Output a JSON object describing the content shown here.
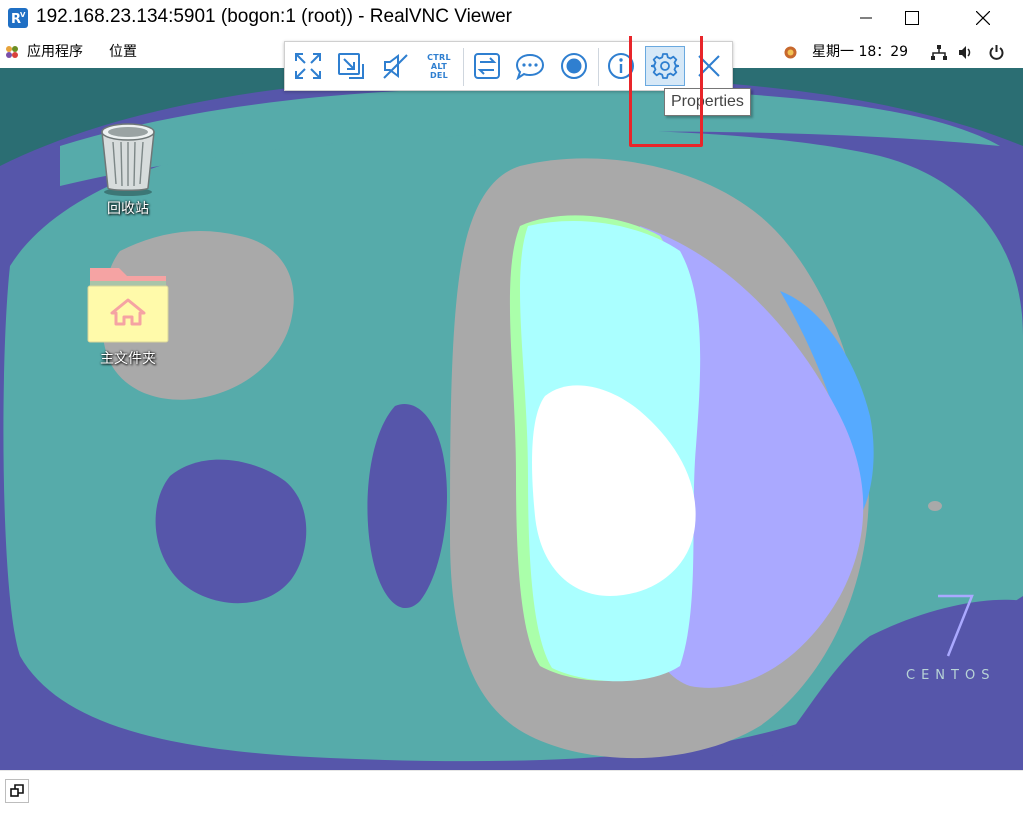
{
  "window": {
    "title": "192.168.23.134:5901 (bogon:1 (root)) - RealVNC Viewer",
    "logo_icon": "realvnc-logo-icon",
    "buttons": [
      "minimize-icon",
      "maximize-icon",
      "close-icon"
    ]
  },
  "panel": {
    "apps_menu": "应用程序",
    "places_menu": "位置",
    "clock": "星期一 18：29",
    "tray_icons": [
      "weather-icon",
      "network-icon",
      "volume-icon",
      "power-icon"
    ]
  },
  "toolbar": {
    "buttons": [
      {
        "name": "fullscreen",
        "icon": "expand-icon"
      },
      {
        "name": "scale",
        "icon": "scale-icon"
      },
      {
        "name": "audio",
        "icon": "mute-icon"
      },
      {
        "name": "ctrl-alt-del",
        "icon": "ctrl-alt-del-icon",
        "lines": [
          "CTRL",
          "ALT",
          "DEL"
        ]
      },
      {
        "name": "transfer",
        "icon": "transfer-icon"
      },
      {
        "name": "chat",
        "icon": "chat-icon"
      },
      {
        "name": "record",
        "icon": "record-icon"
      },
      {
        "name": "info",
        "icon": "info-icon"
      },
      {
        "name": "properties",
        "icon": "gear-icon"
      },
      {
        "name": "close-toolbar",
        "icon": "close-icon"
      }
    ],
    "tooltip": "Properties",
    "active_button": "properties"
  },
  "desktop": {
    "icons": [
      {
        "label": "回收站",
        "icon": "trash-icon"
      },
      {
        "label": "主文件夹",
        "icon": "home-folder-icon"
      }
    ],
    "watermark": {
      "number": "7",
      "text": "CENTOS"
    }
  },
  "colors": {
    "accent": "#2f7fd0",
    "highlight": "#e8252a",
    "teal": "#56abaa",
    "purple": "#5656aa",
    "gray": "#a9a9a9",
    "lavender": "#aaa9ff",
    "cyan": "#aaffff",
    "light_blue": "#56aaff"
  }
}
